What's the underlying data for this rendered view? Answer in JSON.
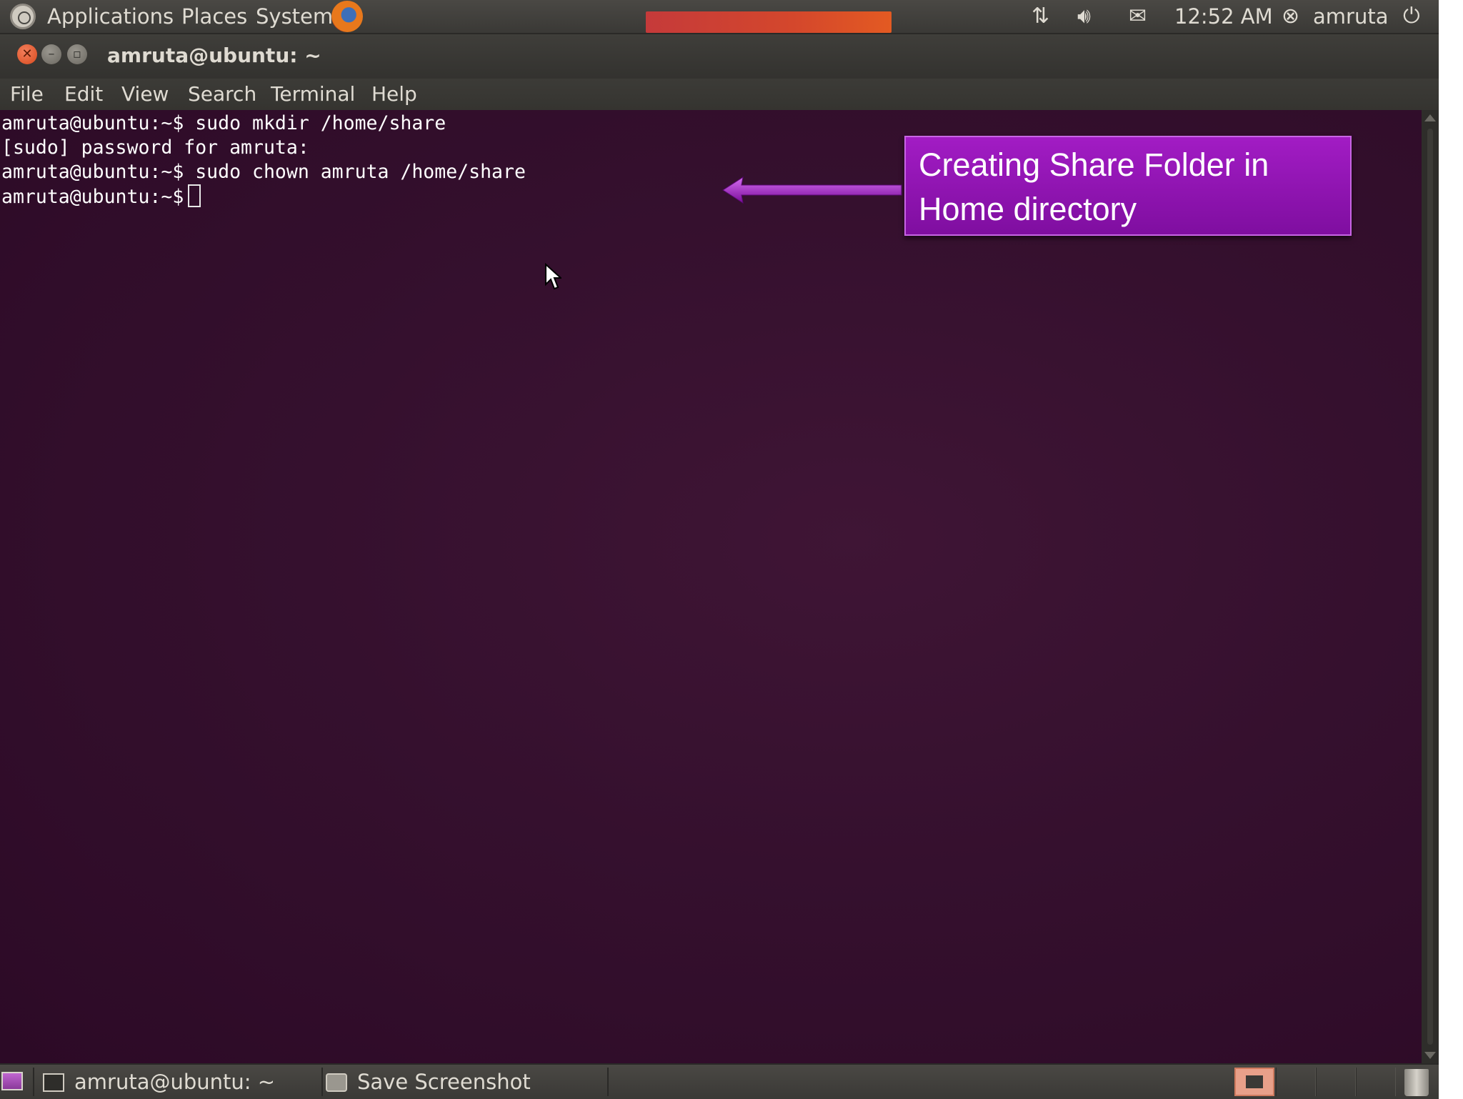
{
  "top_panel": {
    "menus": [
      "Applications",
      "Places",
      "System"
    ],
    "clock": "12:52 AM",
    "user": "amruta"
  },
  "window": {
    "title": "amruta@ubuntu: ~",
    "menu": [
      "File",
      "Edit",
      "View",
      "Search",
      "Terminal",
      "Help"
    ]
  },
  "terminal": {
    "lines": [
      "amruta@ubuntu:~$ sudo mkdir /home/share",
      "[sudo] password for amruta:",
      "amruta@ubuntu:~$ sudo chown amruta /home/share"
    ],
    "prompt": "amruta@ubuntu:~$"
  },
  "annotation": {
    "text": "Creating Share Folder in Home directory",
    "color": "#9218b8"
  },
  "taskbar": {
    "tasks": [
      "amruta@ubuntu: ~",
      "Save Screenshot"
    ]
  },
  "colors": {
    "terminal_bg": "#35102e",
    "panel_bg": "#3c3b37",
    "close_button": "#e05a2c"
  }
}
